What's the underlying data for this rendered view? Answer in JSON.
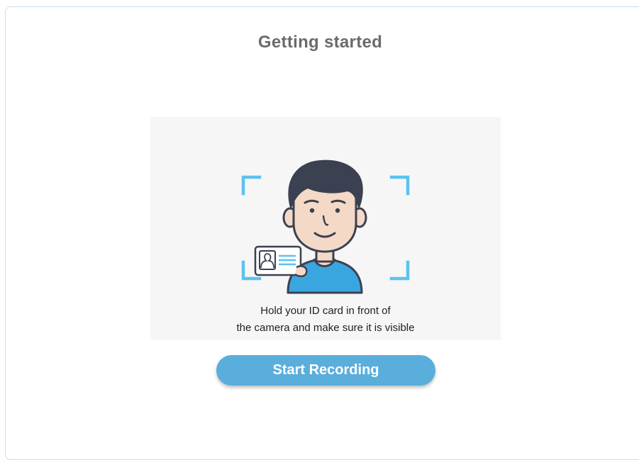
{
  "page": {
    "title": "Getting started"
  },
  "illustration": {
    "icon": "person-holding-id-card-illustration",
    "caption_line1": "Hold your ID card in front of",
    "caption_line2": "the camera and make sure it is visible"
  },
  "actions": {
    "start_label": "Start Recording"
  },
  "colors": {
    "accent": "#5aaedc",
    "frame_corners": "#5cc2ee",
    "shirt": "#3aa6e0",
    "hair": "#3b4150",
    "skin": "#f4d9c6",
    "title_text": "#6b6b6b"
  }
}
